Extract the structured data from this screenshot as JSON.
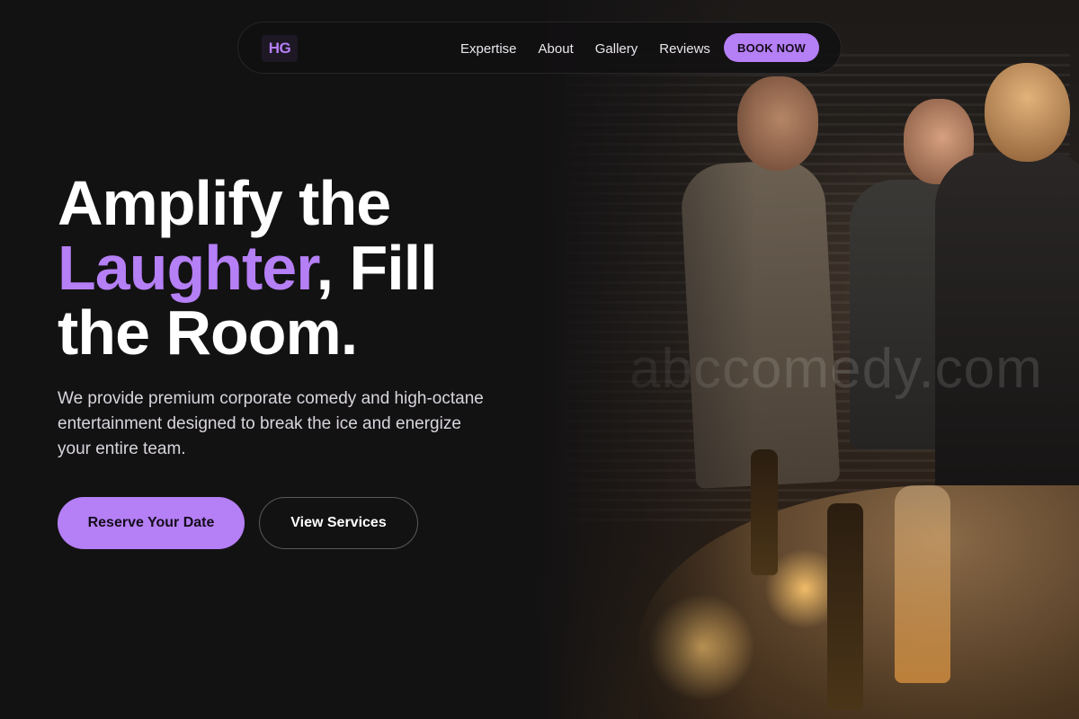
{
  "brand": {
    "logo": "HG"
  },
  "nav": {
    "links": [
      "Expertise",
      "About",
      "Gallery",
      "Reviews"
    ],
    "cta": "BOOK NOW"
  },
  "hero": {
    "title_line1": "Amplify the",
    "title_accent": "Laughter",
    "title_after_accent": ", Fill",
    "title_line3": "the Room.",
    "description": "We provide premium corporate comedy and high-octane entertainment designed to break the ice and energize your entire team.",
    "primary_button": "Reserve Your Date",
    "secondary_button": "View Services"
  },
  "photo": {
    "watermark": "abccomedy.com"
  },
  "colors": {
    "accent": "#b57ff6",
    "background": "#131213"
  }
}
